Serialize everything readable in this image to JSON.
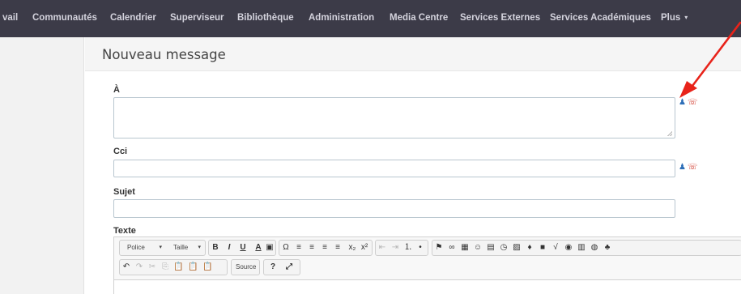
{
  "nav": {
    "items": [
      "vail",
      "Communautés",
      "Calendrier",
      "Superviseur",
      "Bibliothèque",
      "Administration",
      "Media Centre",
      "Services Externes",
      "Services Académiques",
      "Plus"
    ],
    "plus_caret": "▾"
  },
  "page_title": "Nouveau message",
  "form": {
    "to_label": "À",
    "to_value": "",
    "bcc_label": "Cci",
    "bcc_value": "",
    "subject_label": "Sujet",
    "subject_value": "",
    "text_label": "Texte"
  },
  "editor": {
    "font_label": "Police",
    "size_label": "Taille",
    "source_label": "Source",
    "help_label": "?",
    "row1_icons": [
      "B",
      "I",
      "U",
      "A",
      "▣",
      "Ω",
      "≡",
      "≡",
      "≡",
      "≡",
      "x₂",
      "x²",
      "⇤",
      "⇥",
      "⒈",
      "•",
      "⚑",
      "∞",
      "▦",
      "☺",
      "▤",
      "◷",
      "▨",
      "♦",
      "■",
      "√",
      "◉",
      "▥",
      "◍",
      "♣"
    ],
    "row2_icons": [
      "↶",
      "↷",
      "✂",
      "⎘",
      "📋",
      "📋",
      "📋",
      "⤢"
    ]
  },
  "colors": {
    "nav_bg": "#3c3b48",
    "nav_text": "#d4d3dd",
    "accent_arrow": "#e8231a",
    "person_icon": "#2f6fb8",
    "phone_icon": "#d0392b"
  }
}
